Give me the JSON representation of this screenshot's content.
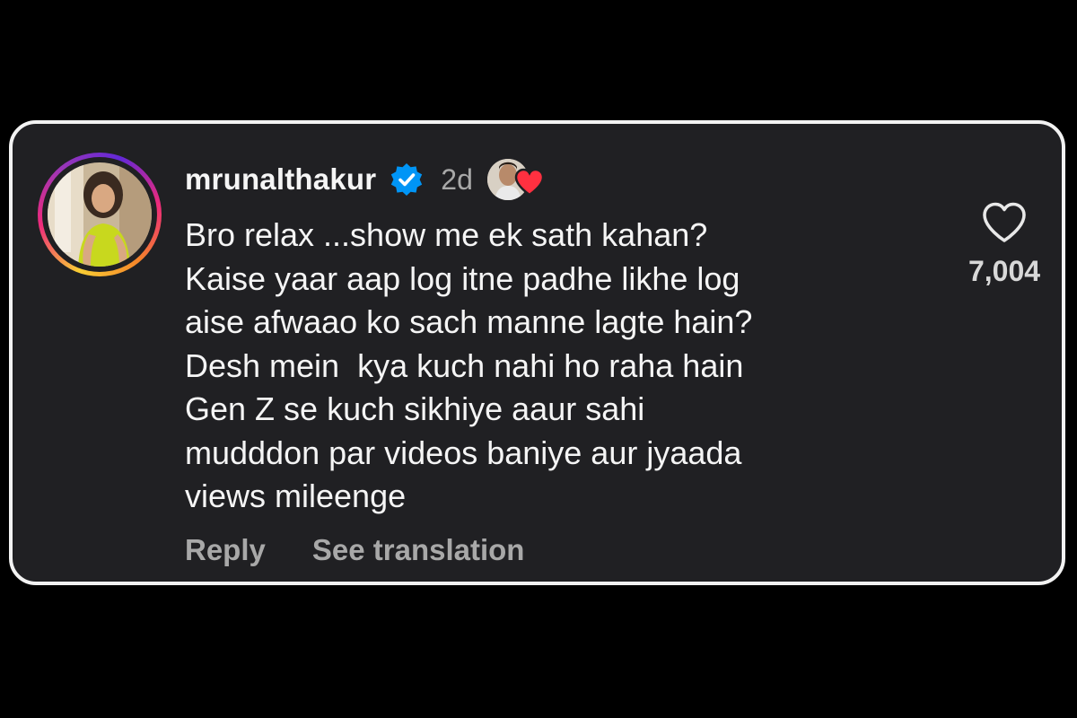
{
  "comment": {
    "username": "mrunalthakur",
    "timestamp": "2d",
    "verified_icon": "verified-badge-icon",
    "liked_by_author_icon": "creator-heart-icon",
    "text": "Bro relax ...show me ek sath kahan?\nKaise yaar aap log itne padhe likhe log\naise afwaao ko sach manne lagte hain?\nDesh mein  kya kuch nahi ho raha hain\nGen Z se kuch sikhiye aaur sahi\nmudddon par videos baniye aur jyaada\nviews mileenge",
    "like_count": "7,004",
    "actions": {
      "reply": "Reply",
      "see_translation": "See translation"
    }
  },
  "colors": {
    "card_background": "#202023",
    "card_border": "#f2f2f2",
    "page_background": "#000000",
    "text_primary": "#f5f5f5",
    "text_secondary": "#a8a8a8",
    "verified_blue": "#0095f6",
    "heart_red": "#ff3040"
  }
}
